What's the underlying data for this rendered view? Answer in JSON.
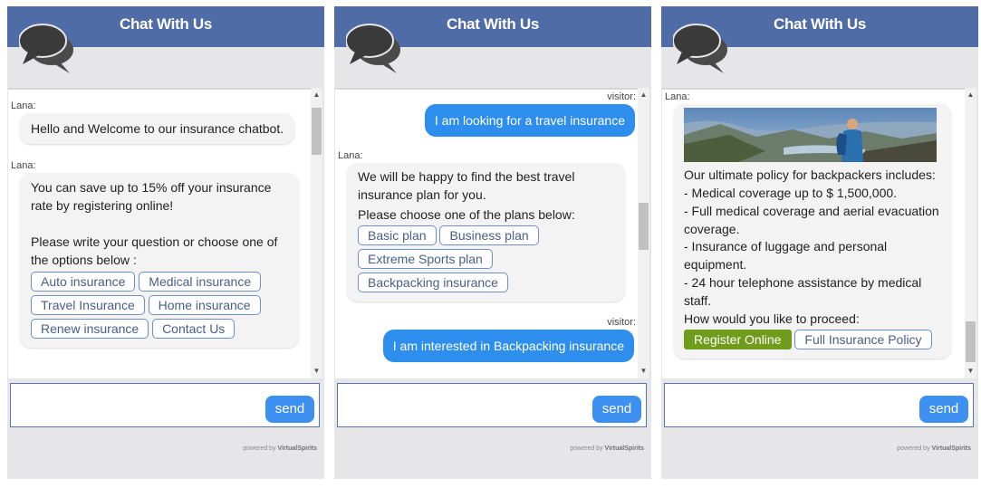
{
  "header": {
    "title": "Chat With Us"
  },
  "bot_name": "Lana:",
  "visitor_label": "visitor:",
  "input": {
    "send_label": "send",
    "placeholder": ""
  },
  "footer": {
    "powered_prefix": "powered by",
    "powered_brand": "VirtualSpirits"
  },
  "panel1": {
    "welcome": "Hello and Welcome to our insurance chatbot.",
    "save_text": "You can save up to 15% off your insurance rate by registering online!",
    "prompt": "Please write your question or choose one of the options below :",
    "options": [
      "Auto insurance",
      "Medical insurance",
      "Travel Insurance",
      "Home insurance",
      "Renew insurance",
      "Contact Us"
    ]
  },
  "panel2": {
    "visitor_msg1": "I am looking for a travel insurance",
    "bot_msg1": "We will be happy to find the best travel insurance plan for you.",
    "bot_msg2": "Please choose one of the plans below:",
    "plans": [
      "Basic plan",
      "Business plan",
      "Extreme Sports plan",
      "Backpacking insurance"
    ],
    "visitor_msg2": "I am interested in Backpacking insurance"
  },
  "panel3": {
    "intro": "Our ultimate policy for backpackers includes:",
    "items": [
      "- Medical coverage up to $ 1,500,000.",
      "- Full medical coverage and aerial evacuation coverage.",
      "- Insurance of luggage and personal equipment.",
      "- 24 hour telephone assistance by medical staff."
    ],
    "proceed": "How would you like to proceed:",
    "register_btn": "Register Online",
    "policy_btn": "Full Insurance Policy"
  },
  "colors": {
    "header": "#4f6ca6",
    "accent": "#2e8eee",
    "green": "#6f9d1b"
  }
}
